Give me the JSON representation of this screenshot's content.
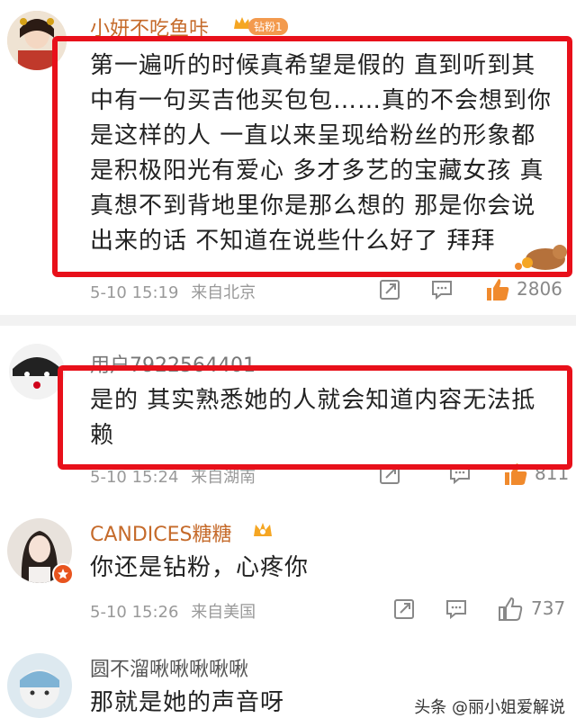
{
  "comments": [
    {
      "username": "小妍不吃鱼咔",
      "badge": "钻粉1",
      "text": "第一遍听的时候真希望是假的 直到听到其中有一句买吉他买包包……真的不会想到你是这样的人 一直以来呈现给粉丝的形象都是积极阳光有爱心 多才多艺的宝藏女孩 真真想不到背地里你是那么想的 那是你会说出来的话 不知道在说些什么好了 拜拜",
      "time": "5-10 15:19",
      "location": "来自北京",
      "likes": "2806"
    },
    {
      "username": "用户7922564401",
      "text": "是的 其实熟悉她的人就会知道内容无法抵赖",
      "time": "5-10 15:24",
      "location": "来自湖南",
      "likes": "811"
    },
    {
      "username": "CANDICES糖糖",
      "text": "你还是钻粉，心疼你",
      "time": "5-10 15:26",
      "location": "来自美国",
      "likes": "737"
    },
    {
      "username": "圆不溜啾啾啾啾啾",
      "text": "那就是她的声音呀"
    }
  ],
  "watermark": "头条 @丽小姐爱解说",
  "colors": {
    "highlight": "#e8101a",
    "username": "#c56a2a",
    "meta": "#999999"
  }
}
